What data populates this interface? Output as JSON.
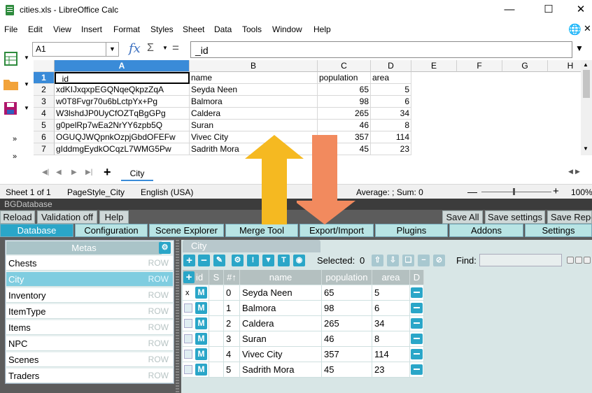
{
  "window": {
    "title": "cities.xls - LibreOffice Calc"
  },
  "menu": [
    "File",
    "Edit",
    "View",
    "Insert",
    "Format",
    "Styles",
    "Sheet",
    "Data",
    "Tools",
    "Window",
    "Help"
  ],
  "formula": {
    "cell_ref": "A1",
    "fx": "fx",
    "sigma": "Σ",
    "equals": "=",
    "value": "_id"
  },
  "spreadsheet": {
    "columns": [
      "A",
      "B",
      "C",
      "D",
      "E",
      "F",
      "G",
      "H"
    ],
    "rows": [
      {
        "n": "1",
        "id": "_id",
        "name": "name",
        "population": "population",
        "area": "area"
      },
      {
        "n": "2",
        "id": "xdKIJxqxpEGQNqeQkpzZqA",
        "name": "Seyda Neen",
        "population": "65",
        "area": "5"
      },
      {
        "n": "3",
        "id": "w0T8Fvgr70u6bLctpYx+Pg",
        "name": "Balmora",
        "population": "98",
        "area": "6"
      },
      {
        "n": "4",
        "id": "W3lshdJP0UyCfOZTqBgGPg",
        "name": "Caldera",
        "population": "265",
        "area": "34"
      },
      {
        "n": "5",
        "id": "g0pelRp7wEa2NrYY6zpb5Q",
        "name": "Suran",
        "population": "46",
        "area": "8"
      },
      {
        "n": "6",
        "id": "OGUQJWQpnkOzpjGbdOFEFw",
        "name": "Vivec City",
        "population": "357",
        "area": "114"
      },
      {
        "n": "7",
        "id": "gIddmgEydkOCqzL7WMG5Pw",
        "name": "Sadrith Mora",
        "population": "45",
        "area": "23"
      }
    ],
    "sheet_tab": "City"
  },
  "status": {
    "sheet": "Sheet 1 of 1",
    "page_style": "PageStyle_City",
    "language": "English (USA)",
    "sum": "Average: ; Sum: 0",
    "zoom": "100%"
  },
  "bg": {
    "title": "BGDatabase",
    "top_buttons_left": [
      "Reload",
      "Validation off",
      "Help"
    ],
    "top_buttons_right": [
      "Save All",
      "Save settings",
      "Save Repo"
    ],
    "tabs": [
      "Database",
      "Configuration",
      "Scene Explorer",
      "Merge Tool",
      "Export/Import",
      "Plugins",
      "Addons",
      "Settings"
    ],
    "metas_header": "Metas",
    "metas": [
      {
        "name": "Chests",
        "type": "ROW"
      },
      {
        "name": "City",
        "type": "ROW"
      },
      {
        "name": "Inventory",
        "type": "ROW"
      },
      {
        "name": "ItemType",
        "type": "ROW"
      },
      {
        "name": "Items",
        "type": "ROW"
      },
      {
        "name": "NPC",
        "type": "ROW"
      },
      {
        "name": "Scenes",
        "type": "ROW"
      },
      {
        "name": "Traders",
        "type": "ROW"
      }
    ],
    "city_tab": "City",
    "selected_label": "Selected:",
    "selected_count": "0",
    "find_label": "Find:",
    "table_headers": [
      "id",
      "S",
      "#↑",
      "name",
      "population",
      "area",
      "D"
    ],
    "rows": [
      {
        "idx": "0",
        "name": "Seyda Neen",
        "population": "65",
        "area": "5",
        "mark": "x"
      },
      {
        "idx": "1",
        "name": "Balmora",
        "population": "98",
        "area": "6",
        "mark": ""
      },
      {
        "idx": "2",
        "name": "Caldera",
        "population": "265",
        "area": "34",
        "mark": ""
      },
      {
        "idx": "3",
        "name": "Suran",
        "population": "46",
        "area": "8",
        "mark": ""
      },
      {
        "idx": "4",
        "name": "Vivec City",
        "population": "357",
        "area": "114",
        "mark": ""
      },
      {
        "idx": "5",
        "name": "Sadrith Mora",
        "population": "45",
        "area": "23",
        "mark": ""
      }
    ]
  },
  "colors": {
    "arrow_up": "#f5b921",
    "arrow_down": "#f28a5e",
    "accent": "#2aa6c8"
  }
}
